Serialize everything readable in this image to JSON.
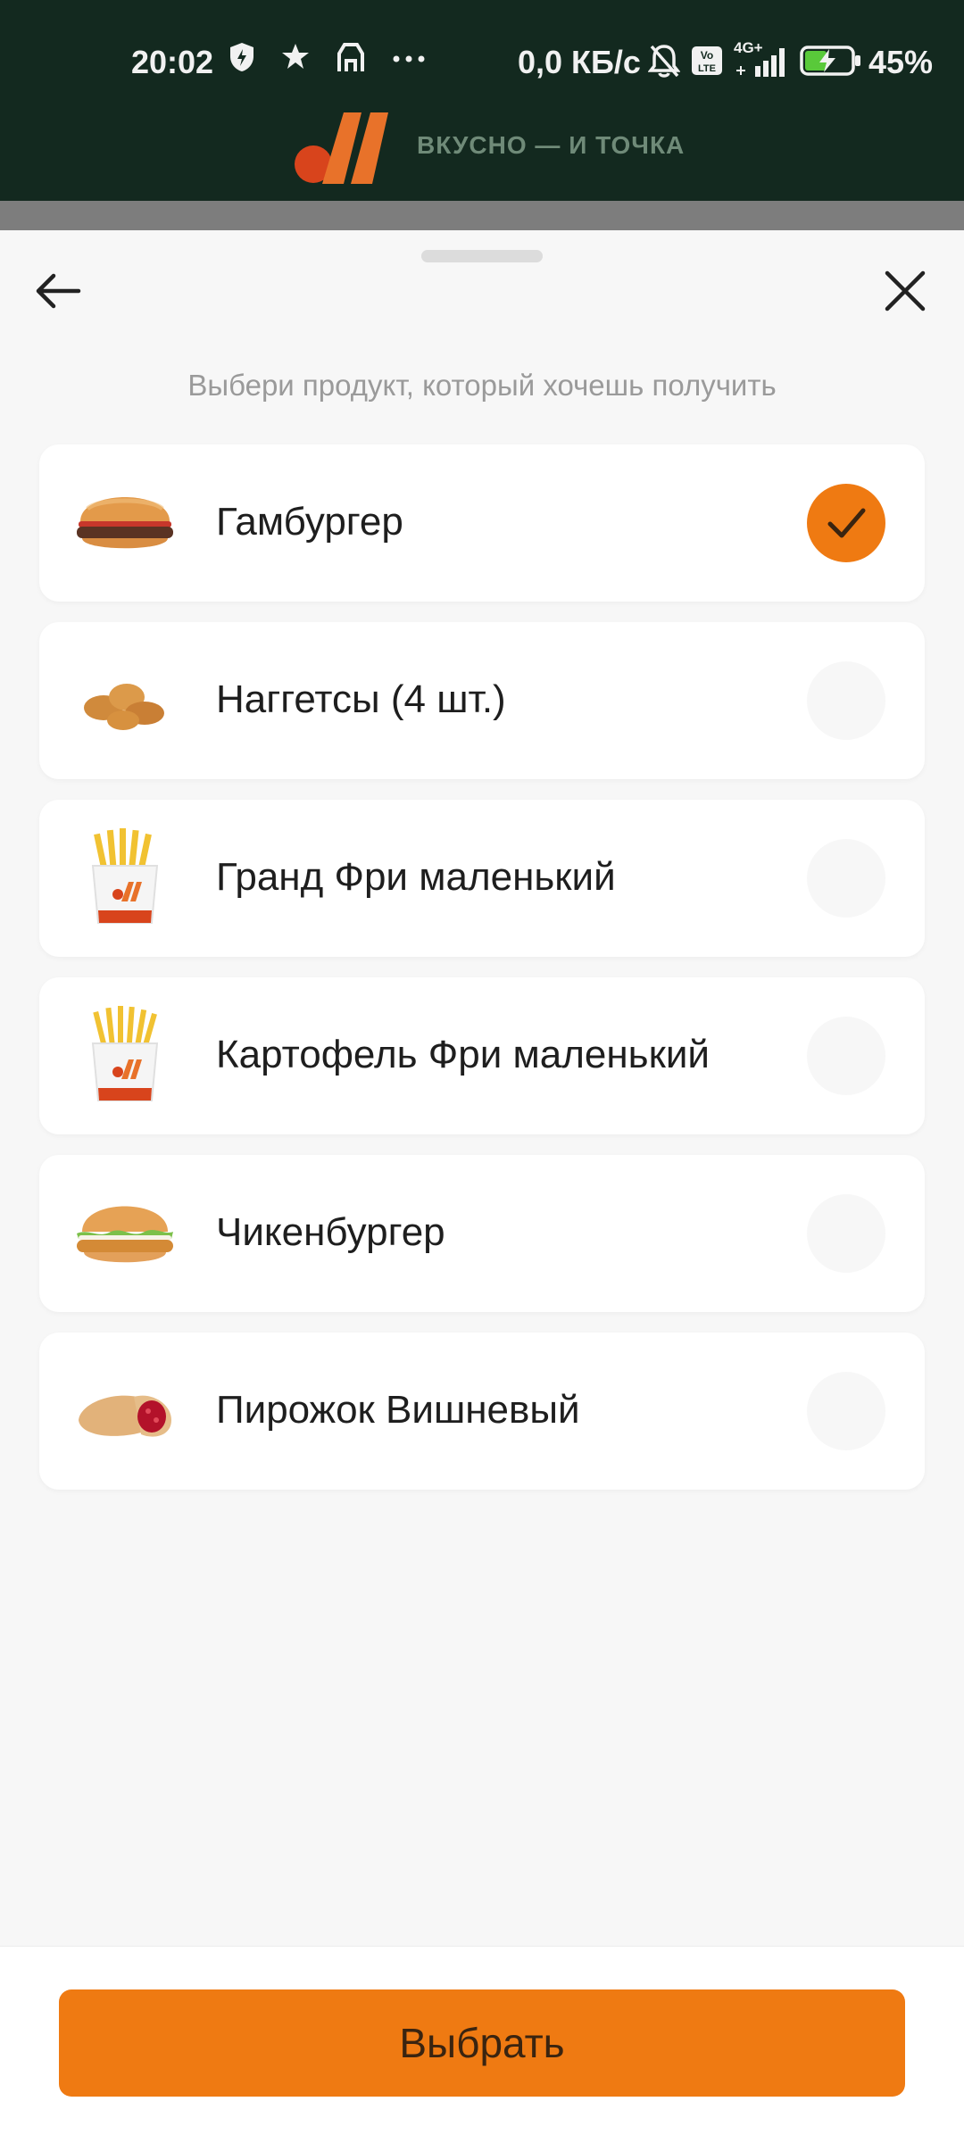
{
  "status_bar": {
    "time": "20:02",
    "network_speed": "0,0 КБ/с",
    "battery": "45%",
    "signal_label": "4G+",
    "volte_label": "Vo LTE",
    "icons_left": [
      "shield-icon",
      "star-icon",
      "bag-icon",
      "more-dots-icon"
    ],
    "icons_right": [
      "mute-bell-icon",
      "volte-icon",
      "signal-icon",
      "battery-charging-icon"
    ]
  },
  "brand": {
    "name": "ВКУСНО — И ТОЧКА",
    "colors": {
      "dot": "#d8441c",
      "mark": "#e8722a",
      "header_bg": "#13291f"
    }
  },
  "sheet": {
    "subtitle": "Выбери продукт, который хочешь получить",
    "back_icon": "arrow-left-icon",
    "close_icon": "close-icon"
  },
  "products": [
    {
      "label": "Гамбургер",
      "selected": true,
      "image": "hamburger"
    },
    {
      "label": "Наггетсы (4 шт.)",
      "selected": false,
      "image": "nuggets"
    },
    {
      "label": "Гранд Фри маленький",
      "selected": false,
      "image": "fries"
    },
    {
      "label": "Картофель Фри маленький",
      "selected": false,
      "image": "fries"
    },
    {
      "label": "Чикенбургер",
      "selected": false,
      "image": "chickenburger"
    },
    {
      "label": "Пирожок Вишневый",
      "selected": false,
      "image": "cherry-pie"
    }
  ],
  "action": {
    "label": "Выбрать",
    "color": "#ef7a12"
  }
}
